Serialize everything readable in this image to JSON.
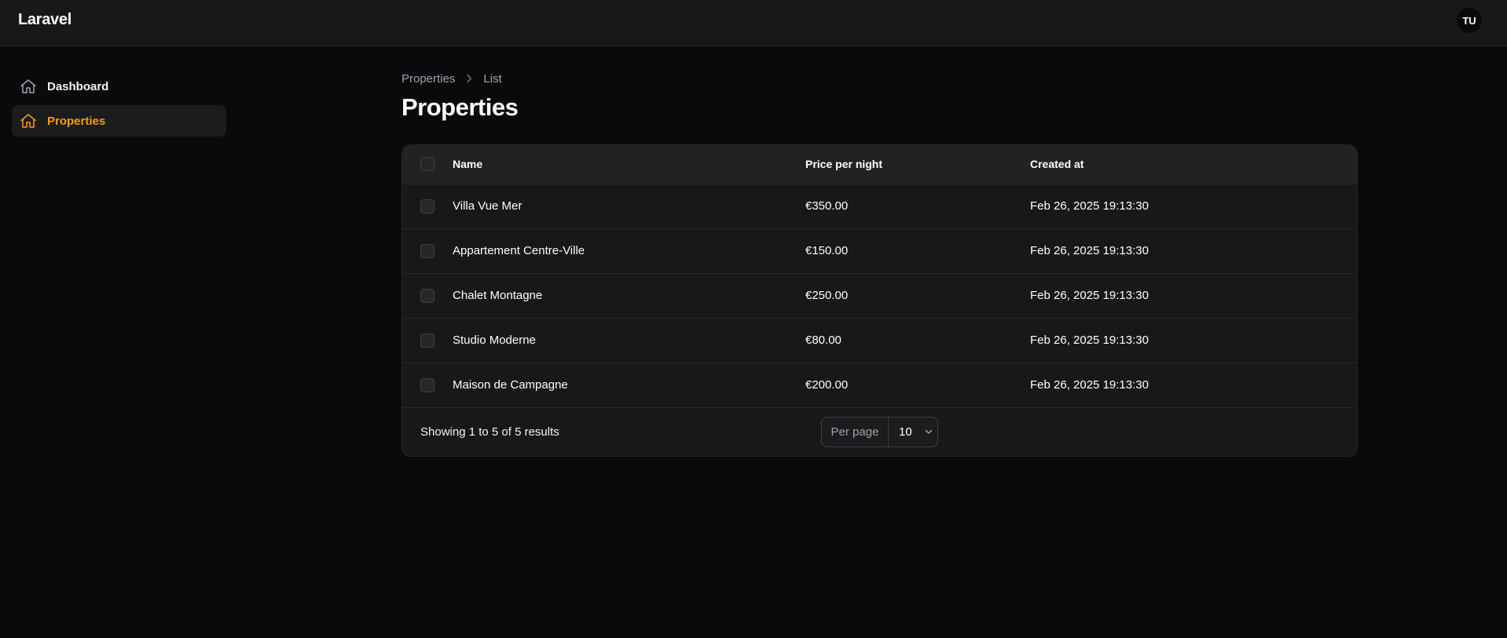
{
  "app": {
    "brand": "Laravel",
    "user_initials": "TU"
  },
  "sidebar": {
    "items": [
      {
        "label": "Dashboard",
        "icon": "home-icon",
        "active": false
      },
      {
        "label": "Properties",
        "icon": "home-icon",
        "active": true
      }
    ]
  },
  "breadcrumb": {
    "parent": "Properties",
    "current": "List"
  },
  "page": {
    "title": "Properties"
  },
  "table": {
    "columns": {
      "name": "Name",
      "price": "Price per night",
      "created": "Created at"
    },
    "rows": [
      {
        "name": "Villa Vue Mer",
        "price": "€350.00",
        "created": "Feb 26, 2025 19:13:30"
      },
      {
        "name": "Appartement Centre-Ville",
        "price": "€150.00",
        "created": "Feb 26, 2025 19:13:30"
      },
      {
        "name": "Chalet Montagne",
        "price": "€250.00",
        "created": "Feb 26, 2025 19:13:30"
      },
      {
        "name": "Studio Moderne",
        "price": "€80.00",
        "created": "Feb 26, 2025 19:13:30"
      },
      {
        "name": "Maison de Campagne",
        "price": "€200.00",
        "created": "Feb 26, 2025 19:13:30"
      }
    ]
  },
  "pagination": {
    "summary": "Showing 1 to 5 of 5 results",
    "per_page_label": "Per page",
    "per_page_value": "10"
  },
  "colors": {
    "accent": "#f59e0b",
    "background": "#0a0a0c",
    "surface": "#18181b"
  }
}
